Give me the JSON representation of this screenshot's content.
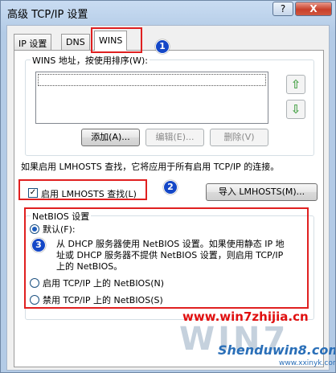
{
  "window": {
    "title": "高级 TCP/IP 设置",
    "help_label": "?",
    "close_label": "X"
  },
  "tabs": [
    {
      "label": "IP 设置"
    },
    {
      "label": "DNS"
    },
    {
      "label": "WINS"
    }
  ],
  "wins_group": {
    "label": "WINS 地址，按使用排序(W):",
    "up_arrow": "⇧",
    "down_arrow": "⇩",
    "add_button": "添加(A)...",
    "edit_button": "编辑(E)...",
    "delete_button": "删除(V)"
  },
  "lmhosts_note": "如果启用 LMHOSTS 查找，它将应用于所有启用 TCP/IP 的连接。",
  "lmhosts_checkbox": {
    "label": "启用 LMHOSTS 查找(L)",
    "checked": true,
    "check_mark": "✓"
  },
  "import_button": "导入 LMHOSTS(M)...",
  "netbios": {
    "label": "NetBIOS 设置",
    "default_option": "默认(F):",
    "default_desc_1": "从 DHCP 服务器使用 NetBIOS 设置。如果使用静态 IP 地",
    "default_desc_2": "址或 DHCP 服务器不提供 NetBIOS 设置，则启用 TCP/IP",
    "default_desc_3": "上的 NetBIOS。",
    "enable_option": "启用 TCP/IP 上的 NetBIOS(N)",
    "disable_option": "禁用 TCP/IP 上的 NetBIOS(S)",
    "selected": "default"
  },
  "markers": [
    "1",
    "2",
    "3"
  ],
  "watermark": {
    "url": "www.win7zhijia.cn",
    "logo": "WIN7",
    "site": "Shenduwin8.com",
    "sub": "www.xxinyk.com"
  },
  "colors": {
    "annotation_red": "#e02020",
    "marker_blue": "#1447c7"
  }
}
